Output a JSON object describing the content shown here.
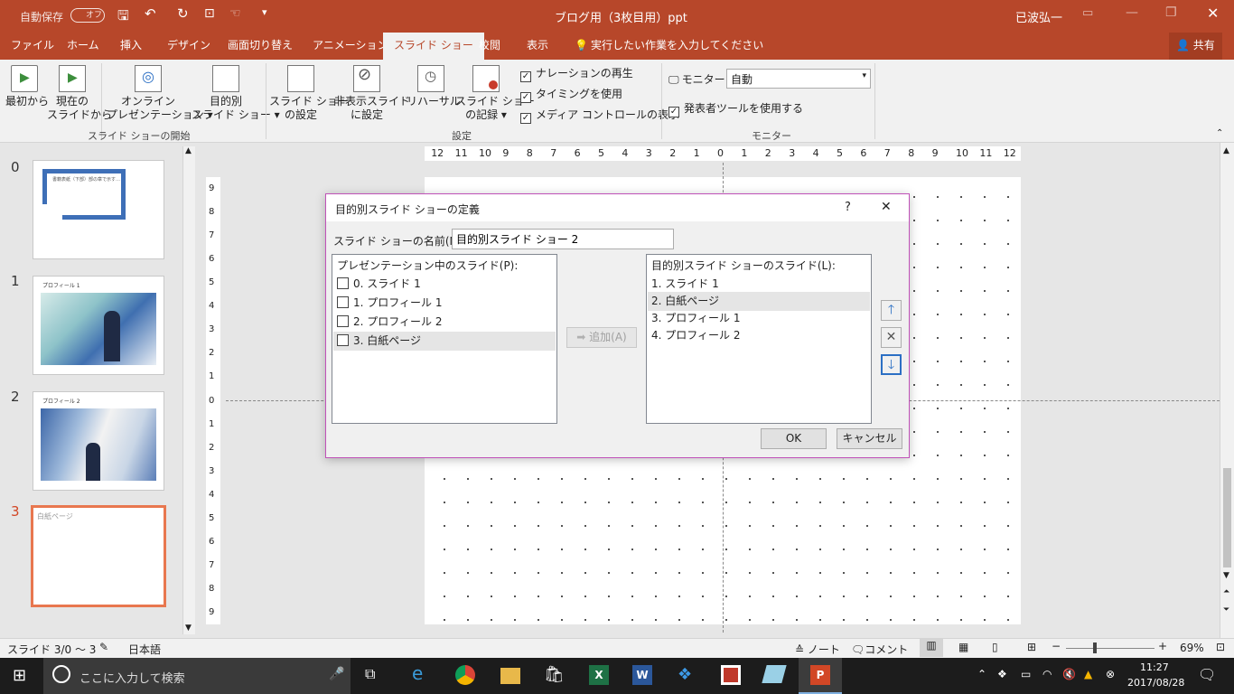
{
  "titlebar": {
    "autosave_label": "自動保存",
    "autosave_toggle": "オフ",
    "doc_title": "ブログ用（3枚目用）ppt",
    "user": "已波弘一"
  },
  "menu": {
    "tabs": [
      "ファイル",
      "ホーム",
      "挿入",
      "デザイン",
      "画面切り替え",
      "アニメーション",
      "スライド ショー",
      "校閲",
      "表示"
    ],
    "active_tab": "スライド ショー",
    "tell_me": "実行したい作業を入力してください",
    "share": "共有"
  },
  "ribbon": {
    "from_beginning": [
      "最初から"
    ],
    "from_current": [
      "現在の",
      "スライドから"
    ],
    "online": [
      "オンライン",
      "プレゼンテーション ▾"
    ],
    "custom": [
      "目的別",
      "スライド ショー ▾"
    ],
    "group_start": "スライド ショーの開始",
    "setup": [
      "スライド ショー",
      "の設定"
    ],
    "hide": [
      "非表示スライド",
      "に設定"
    ],
    "rehearse": "リハーサル",
    "record": [
      "スライド ショー",
      "の記録 ▾"
    ],
    "checks": [
      "ナレーションの再生",
      "タイミングを使用",
      "メディア コントロールの表示"
    ],
    "group_setup": "設定",
    "monitor_label": "モニター:",
    "monitor_value": "自動",
    "presenter_check": "発表者ツールを使用する",
    "group_monitor": "モニター"
  },
  "thumbnails": [
    {
      "num": "0",
      "text": "書籍表紙（下部）部の章で示す…"
    },
    {
      "num": "1",
      "text": "プロフィール 1"
    },
    {
      "num": "2",
      "text": "プロフィール 2"
    },
    {
      "num": "3",
      "text": "白紙ページ"
    }
  ],
  "ruler": {
    "h_ticks": [
      "12",
      "11",
      "10",
      "9",
      "8",
      "7",
      "6",
      "5",
      "4",
      "3",
      "2",
      "1",
      "0",
      "1",
      "2",
      "3",
      "4",
      "5",
      "6",
      "7",
      "8",
      "9",
      "10",
      "11",
      "12"
    ],
    "v_ticks": [
      "9",
      "8",
      "7",
      "6",
      "5",
      "4",
      "3",
      "2",
      "1",
      "0",
      "1",
      "2",
      "3",
      "4",
      "5",
      "6",
      "7",
      "8",
      "9"
    ]
  },
  "dialog": {
    "title": "目的別スライド ショーの定義",
    "help": "?",
    "close": "✕",
    "name_label": "スライド ショーの名前(N):",
    "name_value": "目的別スライド ショー 2",
    "left_header": "プレゼンテーション中のスライド(P):",
    "left_items": [
      "0. スライド 1",
      "1. プロフィール 1",
      "2. プロフィール 2",
      "3. 白紙ページ"
    ],
    "add_button": "追加(A)",
    "right_header": "目的別スライド ショーのスライド(L):",
    "right_items": [
      "1. スライド 1",
      "2. 白紙ページ",
      "3. プロフィール 1",
      "4. プロフィール 2"
    ],
    "ok": "OK",
    "cancel": "キャンセル"
  },
  "status": {
    "slide_info": "スライド 3/0 ～ 3",
    "language": "日本語",
    "notes": "ノート",
    "comments": "コメント",
    "zoom": "69%"
  },
  "taskbar": {
    "search_placeholder": "ここに入力して検索",
    "time": "11:27",
    "date": "2017/08/28"
  }
}
